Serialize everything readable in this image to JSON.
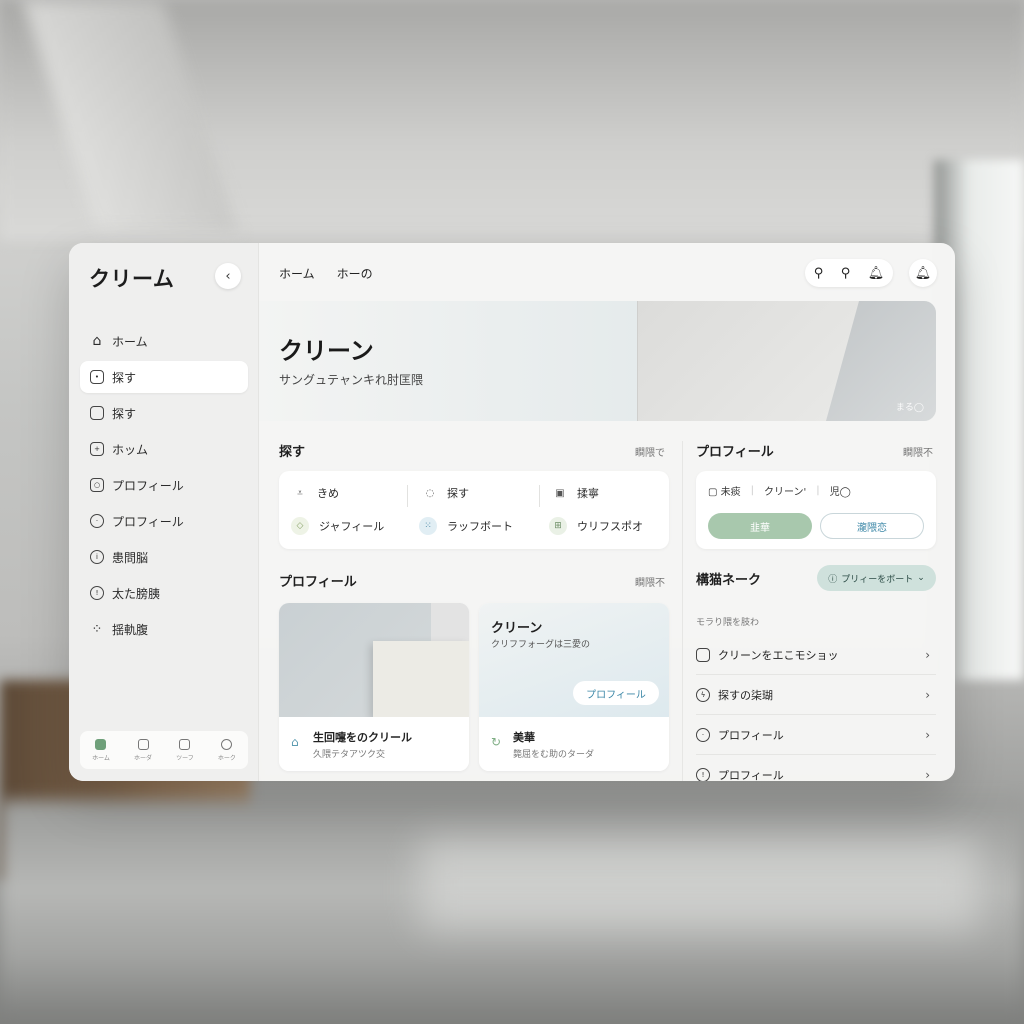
{
  "sidebar": {
    "brand": "クリーム",
    "collapse_icon": "chevron-left-icon",
    "items": [
      {
        "label": "ホーム",
        "icon": "house-icon",
        "active": false
      },
      {
        "label": "探す",
        "icon": "calendar-icon",
        "active": true
      },
      {
        "label": "探す",
        "icon": "folder-icon",
        "active": false
      },
      {
        "label": "ホッム",
        "icon": "grid-icon",
        "active": false
      },
      {
        "label": "プロフィール",
        "icon": "badge-icon",
        "active": false
      },
      {
        "label": "プロフィール",
        "icon": "clock-icon",
        "active": false
      },
      {
        "label": "患問脳",
        "icon": "info-icon",
        "active": false
      },
      {
        "label": "太た膀胰",
        "icon": "alert-icon",
        "active": false
      },
      {
        "label": "揺軌腹",
        "icon": "apps-icon",
        "active": false
      }
    ],
    "bottom": [
      {
        "label": "ホーム",
        "icon": "home-icon"
      },
      {
        "label": "ホーダ",
        "icon": "calendar-icon"
      },
      {
        "label": "ツーフ",
        "icon": "inbox-icon"
      },
      {
        "label": "ホーク",
        "icon": "user-icon"
      }
    ]
  },
  "topbar": {
    "tabs": [
      "ホーム",
      "ホーの"
    ],
    "tools": [
      "search-icon",
      "search-icon",
      "bell-icon"
    ],
    "bell": "bell-icon"
  },
  "hero": {
    "title": "クリーン",
    "subtitle": "サングュテャンキれ肘匡隈",
    "caption": "まる◯"
  },
  "explore": {
    "title": "探す",
    "more": "瞷隈で",
    "items": [
      {
        "label": "きめ",
        "icon": "check-icon"
      },
      {
        "label": "探す",
        "icon": "shield-icon"
      },
      {
        "label": "揉寧",
        "icon": "inbox-icon"
      },
      {
        "label": "ジャフィール",
        "icon": "diamond-icon"
      },
      {
        "label": "ラッフボート",
        "icon": "dotted-icon"
      },
      {
        "label": "ウリフスポオ",
        "icon": "table-icon"
      }
    ]
  },
  "profile_section": {
    "title": "プロフィール",
    "more": "瞷隈不",
    "cards": [
      {
        "title": "生回嚏をのクリール",
        "subtitle": "久隈テタアツク交",
        "icon": "house-icon"
      },
      {
        "title": "クリーン",
        "subtitle": "クリフフォーグは三愛の",
        "button": "プロフィール",
        "foot_title": "美華",
        "foot_subtitle": "斃屈をむ助のターダ",
        "foot_icon": "refresh-icon"
      }
    ]
  },
  "profile_panel": {
    "title": "プロフィール",
    "more": "瞷隈不",
    "row": [
      "未痰",
      "クリーン'",
      "児◯"
    ],
    "primary_button": "韭華",
    "secondary_button": "瀧隈恋"
  },
  "network": {
    "title": "構猫ネーク",
    "pill": "プリィーをボート",
    "caption": "モラり隈を肢わ",
    "rows": [
      {
        "label": "クリーンをエこモショッ",
        "icon": "inbox-icon"
      },
      {
        "label": "探すの柒瑚",
        "icon": "bolt-icon"
      },
      {
        "label": "プロフィール",
        "icon": "clock-icon"
      },
      {
        "label": "プロフィール",
        "icon": "alert-icon"
      }
    ]
  },
  "colors": {
    "accent_green": "#a8c8ad",
    "accent_blue": "#3a86a6",
    "pill_bg": "#cfe1dc"
  }
}
